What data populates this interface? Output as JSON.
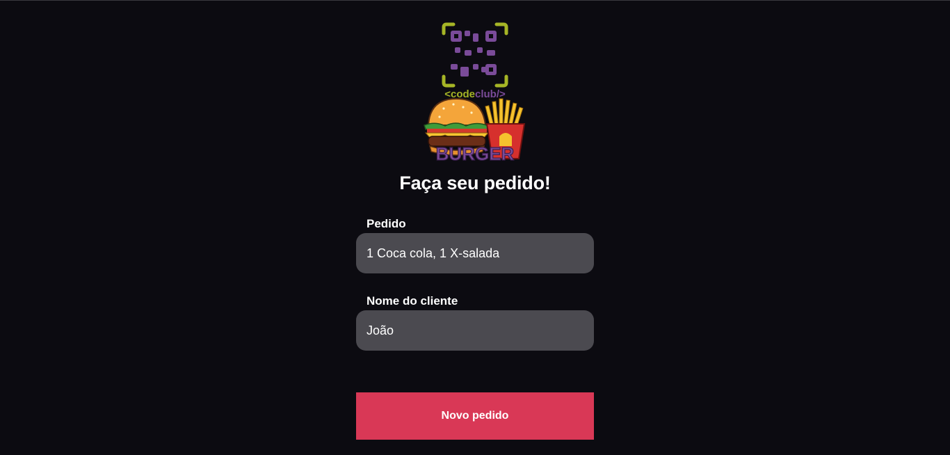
{
  "logo": {
    "brand_prefix": "<",
    "brand_code": "code",
    "brand_club": "club",
    "brand_suffix": "/>",
    "wordmark": "BURGER",
    "colors": {
      "frame": "#a6b526",
      "qr": "#7a4b99",
      "bun": "#f4a53a",
      "fries": "#f5c22e",
      "box": "#d6302d"
    }
  },
  "page": {
    "title": "Faça seu pedido!"
  },
  "form": {
    "order": {
      "label": "Pedido",
      "value": "1 Coca cola, 1 X-salada"
    },
    "customer": {
      "label": "Nome do cliente",
      "value": "João"
    },
    "submit_label": "Novo pedido"
  },
  "colors": {
    "background": "#0c0b11",
    "field": "#4b4a50",
    "button": "#d93856"
  }
}
